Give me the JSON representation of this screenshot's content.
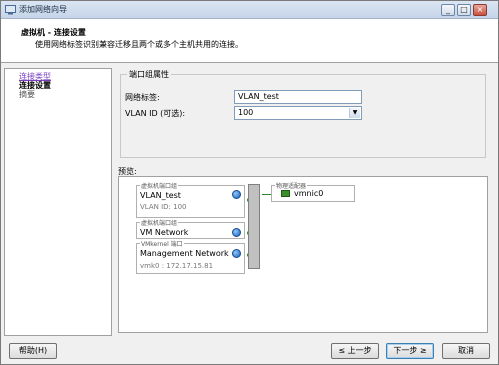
{
  "window": {
    "title": "添加网络向导",
    "controls": [
      "_",
      "□",
      "×"
    ]
  },
  "header": {
    "title": "虚拟机 - 连接设置",
    "subtitle": "使用网络标签识别兼容迁移且两个或多个主机共用的连接。"
  },
  "nav": {
    "items": [
      {
        "label": "连接类型",
        "state": "done"
      },
      {
        "label": "连接设置",
        "state": "active"
      },
      {
        "label": "摘要",
        "state": "future"
      }
    ]
  },
  "port_group": {
    "legend": "端口组属性",
    "network_label_label": "网络标签:",
    "network_label_value": "VLAN_test",
    "vlan_label": "VLAN ID (可选):",
    "vlan_value": "100"
  },
  "preview": {
    "label": "预览:",
    "portgroups": [
      {
        "caption": "虚拟机端口组",
        "name": "VLAN_test",
        "sub": "VLAN ID: 100"
      },
      {
        "caption": "虚拟机端口组",
        "name": "VM Network",
        "sub": ""
      },
      {
        "caption": "VMkernel 端口",
        "name": "Management Network",
        "sub": "vmk0 : 172.17.15.81"
      }
    ],
    "adapter": {
      "caption": "物理适配器",
      "name": "vmnic0"
    }
  },
  "buttons": {
    "help": "帮助(H)",
    "back": "≤ 上一步",
    "next": "下一步 ≥",
    "cancel": "取消"
  },
  "colors": {
    "accent": "#3c7fb1",
    "link": "#7a3fc0",
    "connection": "#2c8a2c"
  }
}
